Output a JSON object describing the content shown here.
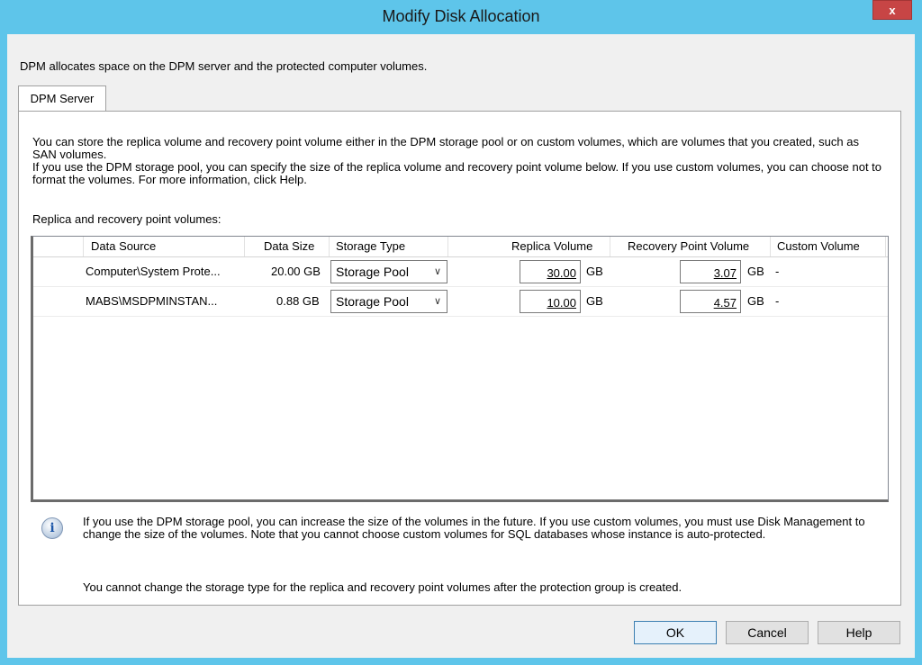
{
  "window": {
    "title": "Modify Disk Allocation",
    "close_label": "x"
  },
  "intro": "DPM allocates space on the DPM server and the protected computer volumes.",
  "tab": {
    "label": "DPM Server"
  },
  "description": {
    "line1": "You can store the replica volume and recovery point volume either in the DPM storage pool or on custom volumes, which are volumes that you created, such as SAN volumes.",
    "line2": "If you use the DPM storage pool, you can specify the size of the replica volume and recovery point volume below. If you use custom volumes, you can choose not to format the volumes. For more information, click Help."
  },
  "list_label": "Replica and recovery point volumes:",
  "columns": {
    "data_source": "Data Source",
    "data_size": "Data Size",
    "storage_type": "Storage Type",
    "replica_volume": "Replica Volume",
    "recovery_point_volume": "Recovery Point Volume",
    "custom_volume": "Custom Volume"
  },
  "rows": [
    {
      "data_source": "Computer\\System Prote...",
      "data_size": "20.00 GB",
      "storage_type": "Storage Pool",
      "replica": "30.00",
      "replica_unit": "GB",
      "recovery": "3.07",
      "recovery_unit": "GB",
      "custom": "-"
    },
    {
      "data_source": "MABS\\MSDPMINSTAN...",
      "data_size": "0.88 GB",
      "storage_type": "Storage Pool",
      "replica": "10.00",
      "replica_unit": "GB",
      "recovery": "4.57",
      "recovery_unit": "GB",
      "custom": "-"
    }
  ],
  "info_icon": "information-icon",
  "note": {
    "text1": "If you use the DPM storage pool, you can increase the size of the volumes in the future. If you use custom volumes, you must use Disk Management to change the size of the volumes. Note that you cannot choose custom volumes for SQL databases whose instance is auto-protected.",
    "text2": "You cannot change the storage type for the replica and recovery point volumes after the protection group is created."
  },
  "buttons": {
    "ok": "OK",
    "cancel": "Cancel",
    "help": "Help"
  }
}
